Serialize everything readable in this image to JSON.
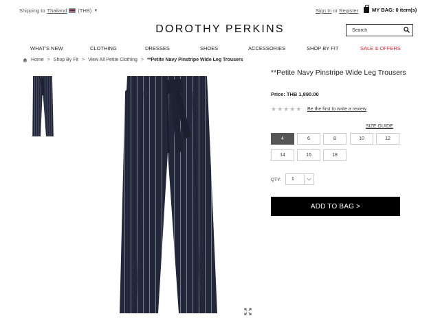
{
  "topbar": {
    "shipping_label": "Shipping to",
    "country": "Thailand",
    "currency": "(THB)",
    "sign_in": "Sign In",
    "or": "or",
    "register": "Register",
    "bag": "MY BAG: 0 item(s)"
  },
  "header": {
    "logo": "DOROTHY PERKINS",
    "search_placeholder": "Search"
  },
  "nav": {
    "items": [
      "WHAT'S NEW",
      "CLOTHING",
      "DRESSES",
      "SHOES",
      "ACCESSORIES",
      "SHOP BY FIT",
      "SALE & OFFERS"
    ]
  },
  "breadcrumb": {
    "items": [
      "Home",
      "Shop By Fit",
      "View All Petite Clothing",
      "**Petite Navy Pinstripe Wide Leg Trousers"
    ],
    "separator": ">"
  },
  "product": {
    "title": "**Petite Navy Pinstripe Wide Leg Trousers",
    "price": "Price: THB 1,890.00",
    "review_link": "Be the first to write a review",
    "rating_stars": 5,
    "size_guide": "SIZE GUIDE",
    "sizes": [
      "4",
      "6",
      "8",
      "10",
      "12",
      "14",
      "16",
      "18"
    ],
    "selected_size": "4",
    "qty_label": "QTY:",
    "qty_value": "1",
    "add_to_bag": "ADD TO BAG >",
    "colors": {
      "trouser": "#23273a",
      "stripe": "#c9cdd8",
      "button": "#000000",
      "sale": "#d6202f"
    }
  }
}
